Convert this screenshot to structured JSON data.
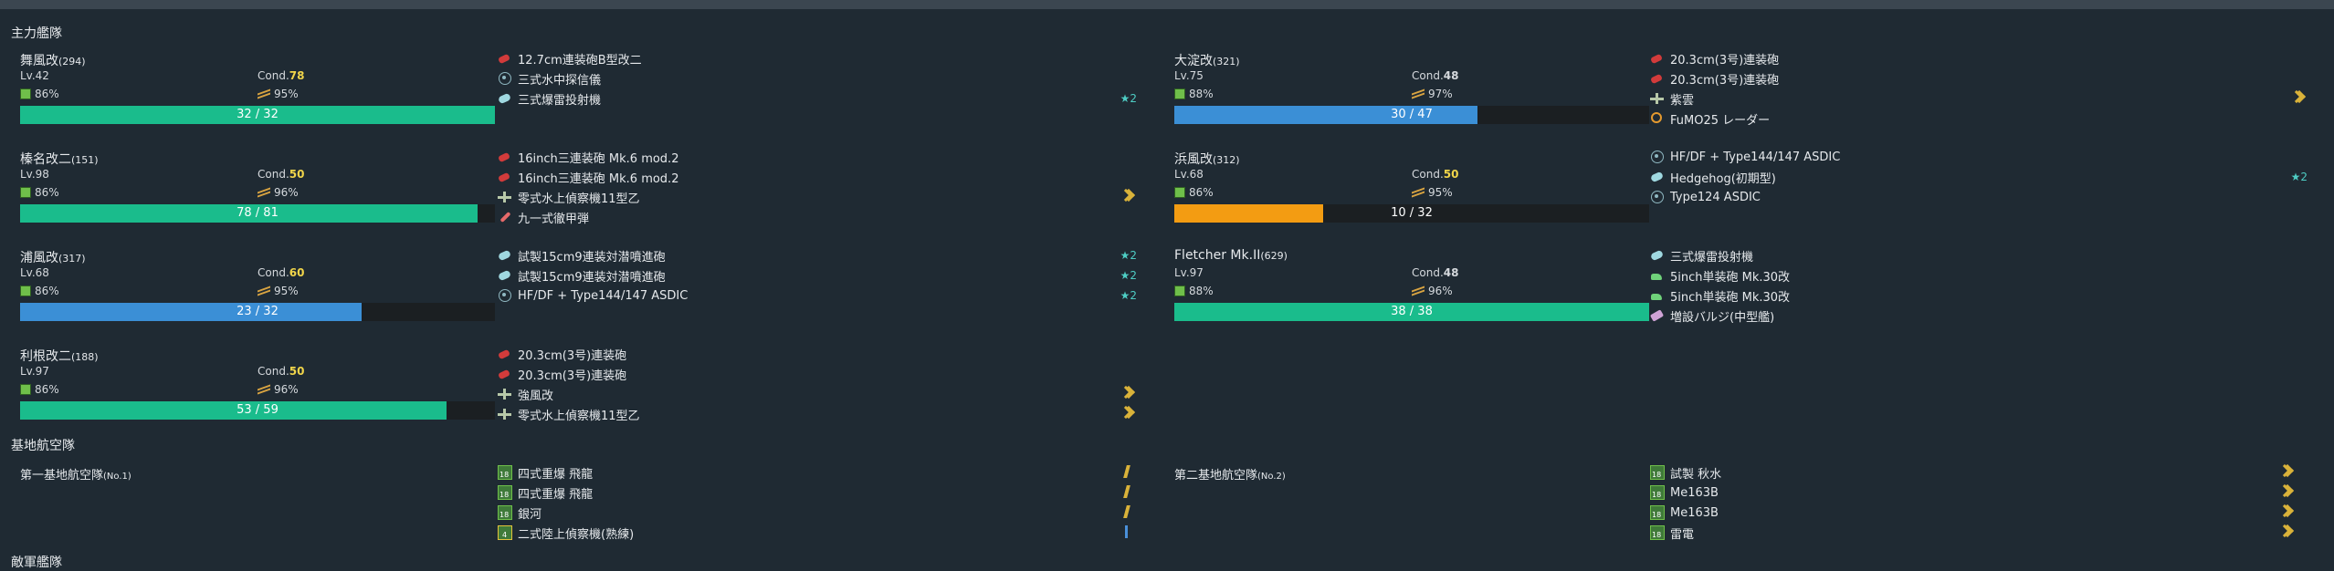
{
  "sections": {
    "main_fleet": "主力艦隊",
    "land_base": "基地航空隊",
    "enemy_fleet": "敵軍艦隊"
  },
  "colors": {
    "hp_green": "#1abc8c",
    "hp_blue": "#3b8fd6",
    "hp_orange": "#f39c12",
    "cond_sparkle": "#f1d54a",
    "improvement": "#4ecdc4",
    "proficiency": "#d9b23a"
  },
  "ships": [
    {
      "name": "舞風改",
      "id": "(294)",
      "lv": "Lv.42",
      "cond_label": "Cond.",
      "cond": "78",
      "fuel": "86%",
      "ammo": "95%",
      "hp": "32 / 32",
      "hp_ratio": 1.0,
      "hp_color": "green",
      "equips": [
        {
          "icon": "gun-red-icon",
          "name": "12.7cm連装砲B型改二",
          "imp": "",
          "prof": ""
        },
        {
          "icon": "sonar-icon",
          "name": "三式水中探信儀",
          "imp": "",
          "prof": ""
        },
        {
          "icon": "depth-charge-icon",
          "name": "三式爆雷投射機",
          "imp": "★2",
          "prof": ""
        }
      ]
    },
    {
      "name": "榛名改二",
      "id": "(151)",
      "lv": "Lv.98",
      "cond_label": "Cond.",
      "cond": "50",
      "fuel": "86%",
      "ammo": "96%",
      "hp": "78 / 81",
      "hp_ratio": 0.963,
      "hp_color": "green",
      "equips": [
        {
          "icon": "gun-red-icon",
          "name": "16inch三連装砲 Mk.6 mod.2",
          "imp": "",
          "prof": ""
        },
        {
          "icon": "gun-red-icon",
          "name": "16inch三連装砲 Mk.6 mod.2",
          "imp": "",
          "prof": ""
        },
        {
          "icon": "seaplane-icon",
          "name": "零式水上偵察機11型乙",
          "imp": "",
          "prof": "chevron"
        },
        {
          "icon": "ap-shell-icon",
          "name": "九一式徹甲弾",
          "imp": "",
          "prof": ""
        }
      ]
    },
    {
      "name": "浦風改",
      "id": "(317)",
      "lv": "Lv.68",
      "cond_label": "Cond.",
      "cond": "60",
      "fuel": "86%",
      "ammo": "95%",
      "hp": "23 / 32",
      "hp_ratio": 0.719,
      "hp_color": "blue",
      "equips": [
        {
          "icon": "depth-charge-icon",
          "name": "試製15cm9連装対潜噴進砲",
          "imp": "★2",
          "prof": ""
        },
        {
          "icon": "depth-charge-icon",
          "name": "試製15cm9連装対潜噴進砲",
          "imp": "★2",
          "prof": ""
        },
        {
          "icon": "sonar-icon",
          "name": "HF/DF + Type144/147 ASDIC",
          "imp": "★2",
          "prof": ""
        }
      ]
    },
    {
      "name": "利根改二",
      "id": "(188)",
      "lv": "Lv.97",
      "cond_label": "Cond.",
      "cond": "50",
      "fuel": "86%",
      "ammo": "96%",
      "hp": "53 / 59",
      "hp_ratio": 0.898,
      "hp_color": "green",
      "equips": [
        {
          "icon": "gun-red-icon",
          "name": "20.3cm(3号)連装砲",
          "imp": "",
          "prof": ""
        },
        {
          "icon": "gun-red-icon",
          "name": "20.3cm(3号)連装砲",
          "imp": "",
          "prof": ""
        },
        {
          "icon": "seaplane-icon",
          "name": "強風改",
          "imp": "",
          "prof": "chevron"
        },
        {
          "icon": "seaplane-icon",
          "name": "零式水上偵察機11型乙",
          "imp": "",
          "prof": "chevron"
        }
      ]
    },
    {
      "name": "大淀改",
      "id": "(321)",
      "lv": "Lv.75",
      "cond_label": "Cond.",
      "cond": "48",
      "fuel": "88%",
      "ammo": "97%",
      "hp": "30 / 47",
      "hp_ratio": 0.638,
      "hp_color": "blue",
      "equips": [
        {
          "icon": "gun-red-icon",
          "name": "20.3cm(3号)連装砲",
          "imp": "",
          "prof": ""
        },
        {
          "icon": "gun-red-icon",
          "name": "20.3cm(3号)連装砲",
          "imp": "",
          "prof": ""
        },
        {
          "icon": "seaplane-icon",
          "name": "紫雲",
          "imp": "",
          "prof": "chevron"
        },
        {
          "icon": "radar-icon",
          "name": "FuMO25 レーダー",
          "imp": "",
          "prof": ""
        }
      ]
    },
    {
      "name": "浜風改",
      "id": "(312)",
      "lv": "Lv.68",
      "cond_label": "Cond.",
      "cond": "50",
      "fuel": "86%",
      "ammo": "95%",
      "hp": "10 / 32",
      "hp_ratio": 0.3125,
      "hp_color": "orange",
      "equips": [
        {
          "icon": "sonar-icon",
          "name": "HF/DF + Type144/147 ASDIC",
          "imp": "",
          "prof": ""
        },
        {
          "icon": "depth-charge-icon",
          "name": "Hedgehog(初期型)",
          "imp": "★2",
          "prof": ""
        },
        {
          "icon": "sonar-icon",
          "name": "Type124 ASDIC",
          "imp": "",
          "prof": ""
        }
      ]
    },
    {
      "name": "Fletcher Mk.II",
      "id": "(629)",
      "lv": "Lv.97",
      "cond_label": "Cond.",
      "cond": "48",
      "fuel": "88%",
      "ammo": "96%",
      "hp": "38 / 38",
      "hp_ratio": 1.0,
      "hp_color": "green",
      "equips": [
        {
          "icon": "depth-charge-icon",
          "name": "三式爆雷投射機",
          "imp": "",
          "prof": ""
        },
        {
          "icon": "gun-green-icon",
          "name": "5inch単装砲 Mk.30改",
          "imp": "",
          "prof": ""
        },
        {
          "icon": "gun-green-icon",
          "name": "5inch単装砲 Mk.30改",
          "imp": "",
          "prof": ""
        },
        {
          "icon": "bulge-icon",
          "name": "増設バルジ(中型艦)",
          "imp": "",
          "prof": ""
        }
      ]
    }
  ],
  "land_bases": [
    {
      "name": "第一基地航空隊",
      "num": "(No.1)",
      "squadrons": [
        {
          "icon": "land-bomber-icon",
          "name": "四式重爆 飛龍",
          "prof": "slash"
        },
        {
          "icon": "land-bomber-icon",
          "name": "四式重爆 飛龍",
          "prof": "slash"
        },
        {
          "icon": "land-bomber-icon",
          "name": "銀河",
          "prof": "slash"
        },
        {
          "icon": "land-recon-icon",
          "name": "二式陸上偵察機(熟練)",
          "prof": "bar"
        }
      ]
    },
    {
      "name": "第二基地航空隊",
      "num": "(No.2)",
      "squadrons": [
        {
          "icon": "land-bomber-icon",
          "name": "試製 秋水",
          "prof": "chevron"
        },
        {
          "icon": "land-bomber-icon",
          "name": "Me163B",
          "prof": "chevron"
        },
        {
          "icon": "land-bomber-icon",
          "name": "Me163B",
          "prof": "chevron"
        },
        {
          "icon": "land-bomber-icon",
          "name": "雷電",
          "prof": "chevron"
        }
      ]
    }
  ]
}
